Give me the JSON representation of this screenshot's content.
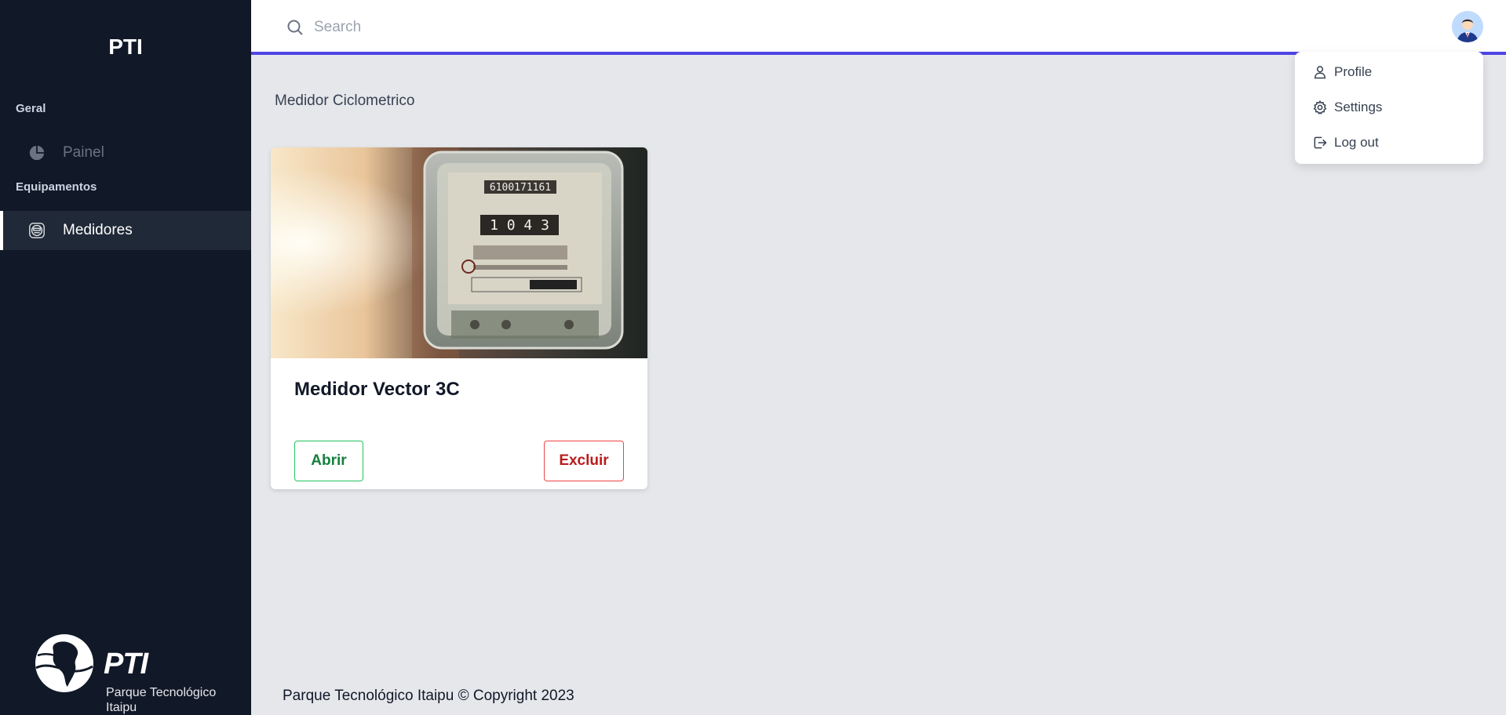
{
  "sidebar": {
    "brand": "PTI",
    "sections": {
      "geral": "Geral",
      "equipamentos": "Equipamentos"
    },
    "items": {
      "painel": {
        "label": "Painel",
        "icon": "pie-chart-icon"
      },
      "medidores": {
        "label": "Medidores",
        "icon": "meter-icon",
        "active": true
      }
    },
    "logo": {
      "text": "PTI",
      "subtitle": "Parque Tecnológico Itaipu"
    }
  },
  "header": {
    "search": {
      "placeholder": "Search",
      "value": ""
    },
    "accent": "#4f46e5"
  },
  "user_menu": {
    "items": {
      "profile": "Profile",
      "settings": "Settings",
      "logout": "Log out"
    }
  },
  "main": {
    "breadcrumb": "Medidor Ciclometrico",
    "card": {
      "display_1": "6100171161",
      "display_2": "1 0 4 3",
      "title": "Medidor Vector 3C",
      "open_label": "Abrir",
      "delete_label": "Excluir"
    }
  },
  "footer": {
    "copyright": "Parque Tecnológico Itaipu © Copyright 2023"
  }
}
